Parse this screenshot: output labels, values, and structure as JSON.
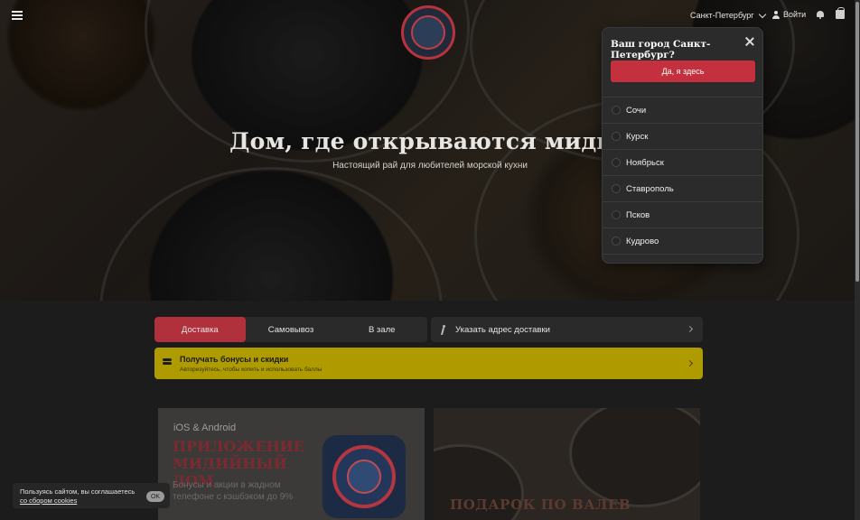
{
  "header": {
    "city": "Санкт-Петербург",
    "login_label": "Войти"
  },
  "hero": {
    "title": "Дом, где открываются мидии",
    "subtitle": "Настоящий рай для любителей морской кухни"
  },
  "city_popup": {
    "title": "Ваш город Санкт-Петербург?",
    "confirm_label": "Да, я здесь",
    "cities": [
      "Сочи",
      "Курск",
      "Ноябрьск",
      "Ставрополь",
      "Псков",
      "Кудрово"
    ]
  },
  "order": {
    "tabs": [
      {
        "label": "Доставка",
        "active": true
      },
      {
        "label": "Самовывоз",
        "active": false
      },
      {
        "label": "В зале",
        "active": false
      }
    ],
    "address_label": "Указать адрес доставки"
  },
  "bonus": {
    "title": "Получать бонусы и скидки",
    "subtitle": "Авторизуйтесь, чтобы копить и использовать баллы"
  },
  "app_promo": {
    "platforms": "iOS & Android",
    "title": "ПРИЛОЖЕНИЕ МИДИЙНЫЙ ДОМ",
    "description": "Бонусы и акции в жадном телефоне с кэшбэком до 9%"
  },
  "promo2": {
    "title": "ПОДАРОК ПО ВАЛЕВ"
  },
  "cookie": {
    "text": "Пользуясь сайтом, вы соглашаетесь",
    "link": "со сбором cookies",
    "ok_label": "OK"
  },
  "colors": {
    "accent": "#c4303d",
    "bonus_bg": "#ad9b00",
    "background": "#1c1c1c"
  }
}
